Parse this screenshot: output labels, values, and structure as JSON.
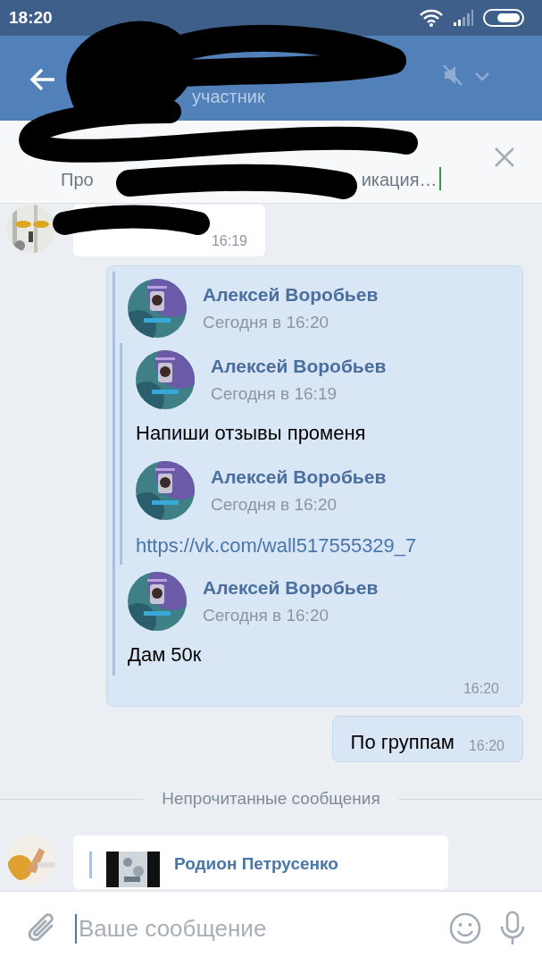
{
  "status_bar": {
    "time": "18:20"
  },
  "header": {
    "subtitle": "участник"
  },
  "pinned": {
    "fragment_start": "Про",
    "fragment_end": "икация…"
  },
  "messages": [
    {
      "kind": "incoming",
      "time": "16:19"
    },
    {
      "kind": "outgoing",
      "time": "16:20",
      "forwards": [
        {
          "author": "Алексей Воробьев",
          "time": "Сегодня в 16:20",
          "children": [
            {
              "author": "Алексей Воробьев",
              "time": "Сегодня в 16:19",
              "text": "Напиши отзывы променя"
            },
            {
              "author": "Алексей Воробьев",
              "time": "Сегодня в 16:20",
              "link": "https://vk.com/wall517555329_7"
            }
          ]
        },
        {
          "author": "Алексей Воробьев",
          "time": "Сегодня в 16:20",
          "text": "Дам 50к"
        }
      ]
    },
    {
      "kind": "outgoing",
      "time": "16:20",
      "text": "По группам"
    },
    {
      "kind": "divider",
      "text": "Непрочитанные сообщения"
    },
    {
      "kind": "incoming",
      "quote_author": "Родион Петрусенко"
    }
  ],
  "composer": {
    "placeholder": "Ваше сообщение"
  }
}
